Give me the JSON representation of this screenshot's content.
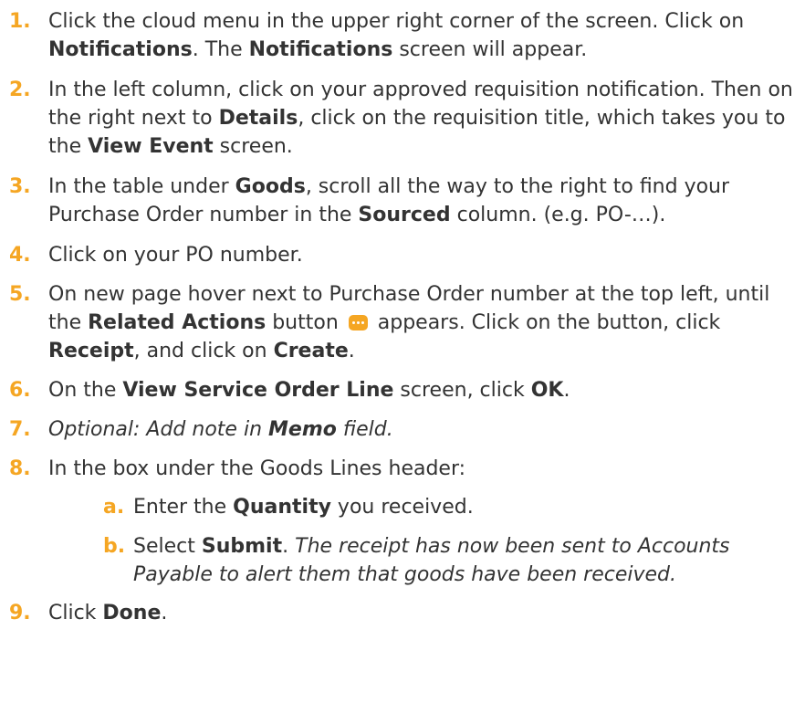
{
  "steps": [
    {
      "num": "1.",
      "parts": [
        "Click the cloud menu in the upper right corner of the screen. Click on ",
        "Notifications",
        ". The ",
        "Notifications",
        " screen will appear."
      ]
    },
    {
      "num": "2.",
      "parts": [
        "In the left column, click on your approved requisition notification. Then on the right next to ",
        "Details",
        ", click on the requisition title, which takes you to the ",
        "View Event",
        " screen."
      ]
    },
    {
      "num": "3.",
      "parts": [
        "In the table under ",
        "Goods",
        ", scroll all the way to the right to find your Purchase Order number in the ",
        "Sourced",
        " column. (e.g. PO-…)."
      ]
    },
    {
      "num": "4.",
      "parts": [
        "Click on your PO number."
      ]
    },
    {
      "num": "5.",
      "parts": [
        "On new page hover next to Purchase Order number at the top left, until the ",
        "Related Actions",
        " button ",
        " appears. Click on the button, click ",
        "Receipt",
        ", and click on ",
        "Create",
        "."
      ]
    },
    {
      "num": "6.",
      "parts": [
        "On the ",
        "View Service Order Line",
        " screen, click ",
        "OK",
        "."
      ]
    },
    {
      "num": "7.",
      "parts": [
        "Optional: Add note in ",
        "Memo",
        " field."
      ]
    },
    {
      "num": "8.",
      "parts": [
        "In the box under the Goods Lines header:"
      ],
      "substeps": [
        {
          "num": "a.",
          "parts": [
            "Enter the ",
            "Quantity",
            " you received."
          ]
        },
        {
          "num": "b.",
          "parts": [
            "Select ",
            "Submit",
            ". ",
            "The receipt has now been sent to Accounts Payable to alert them that goods have been received."
          ]
        }
      ]
    },
    {
      "num": "9.",
      "parts": [
        "Click ",
        "Done",
        "."
      ]
    }
  ],
  "colors": {
    "accent": "#f5a623",
    "text": "#333333",
    "background": "#ffffff"
  },
  "icons": {
    "related_actions": "related-actions-icon"
  }
}
